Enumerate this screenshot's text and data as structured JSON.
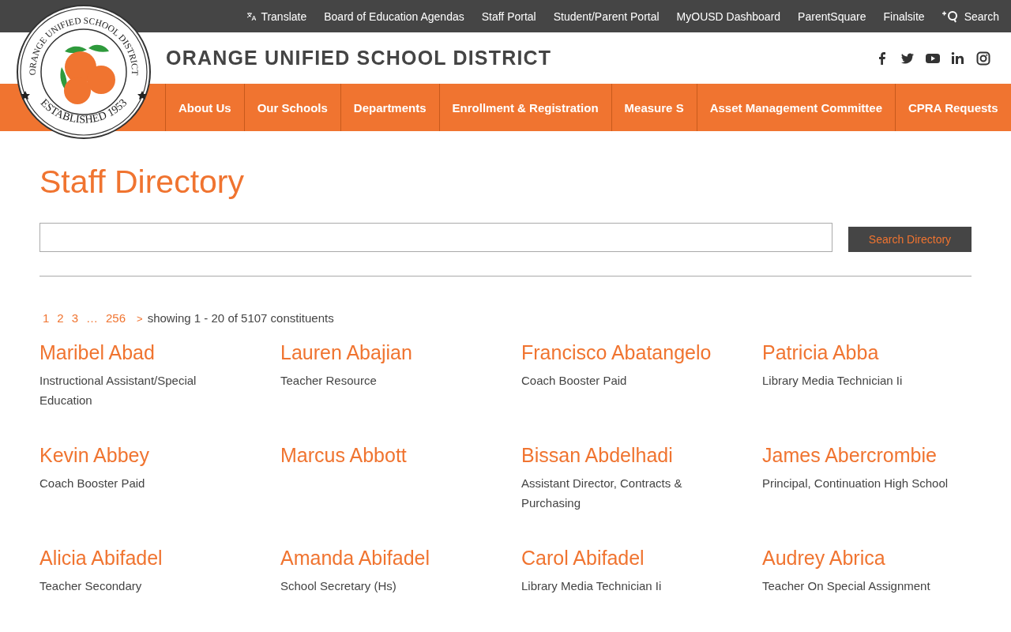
{
  "utility_links": [
    {
      "label": "Translate",
      "kind": "translate"
    },
    {
      "label": "Board of Education Agendas",
      "kind": "link"
    },
    {
      "label": "Staff Portal",
      "kind": "link"
    },
    {
      "label": "Student/Parent Portal",
      "kind": "link"
    },
    {
      "label": "MyOUSD Dashboard",
      "kind": "link"
    },
    {
      "label": "ParentSquare",
      "kind": "link"
    },
    {
      "label": "Finalsite",
      "kind": "link"
    },
    {
      "label": "Search",
      "kind": "search"
    }
  ],
  "logo": {
    "ring_top": "ORANGE UNIFIED SCHOOL DISTRICT",
    "ring_bottom": "ESTABLISHED 1953"
  },
  "site_title": "ORANGE UNIFIED SCHOOL DISTRICT",
  "social": [
    {
      "kind": "facebook"
    },
    {
      "kind": "twitter"
    },
    {
      "kind": "youtube"
    },
    {
      "kind": "linkedin"
    },
    {
      "kind": "instagram"
    }
  ],
  "nav": [
    "About Us",
    "Our Schools",
    "Departments",
    "Enrollment & Registration",
    "Measure S",
    "Asset Management Committee",
    "CPRA Requests"
  ],
  "page_title": "Staff Directory",
  "search_button": "Search Directory",
  "pagination": {
    "pages": [
      {
        "label": "1",
        "kind": "page"
      },
      {
        "label": "2",
        "kind": "page"
      },
      {
        "label": "3",
        "kind": "page"
      },
      {
        "label": "…",
        "kind": "gap"
      },
      {
        "label": "256",
        "kind": "page"
      },
      {
        "label": ">",
        "kind": "next"
      }
    ],
    "summary": "showing 1 - 20 of 5107 constituents"
  },
  "staff": [
    {
      "name": "Maribel Abad",
      "title": "Instructional Assistant/Special Education"
    },
    {
      "name": "Lauren Abajian",
      "title": "Teacher Resource"
    },
    {
      "name": "Francisco Abatangelo",
      "title": "Coach Booster Paid"
    },
    {
      "name": "Patricia Abba",
      "title": "Library Media Technician Ii"
    },
    {
      "name": "Kevin Abbey",
      "title": "Coach Booster Paid"
    },
    {
      "name": "Marcus Abbott"
    },
    {
      "name": "Bissan Abdelhadi",
      "title": "Assistant Director, Contracts & Purchasing"
    },
    {
      "name": "James Abercrombie",
      "title": "Principal, Continuation High School"
    },
    {
      "name": "Alicia Abifadel",
      "title": "Teacher Secondary"
    },
    {
      "name": "Amanda Abifadel",
      "title": "School Secretary (Hs)"
    },
    {
      "name": "Carol Abifadel",
      "title": "Library Media Technician Ii"
    },
    {
      "name": "Audrey Abrica",
      "title": "Teacher On Special Assignment"
    }
  ]
}
